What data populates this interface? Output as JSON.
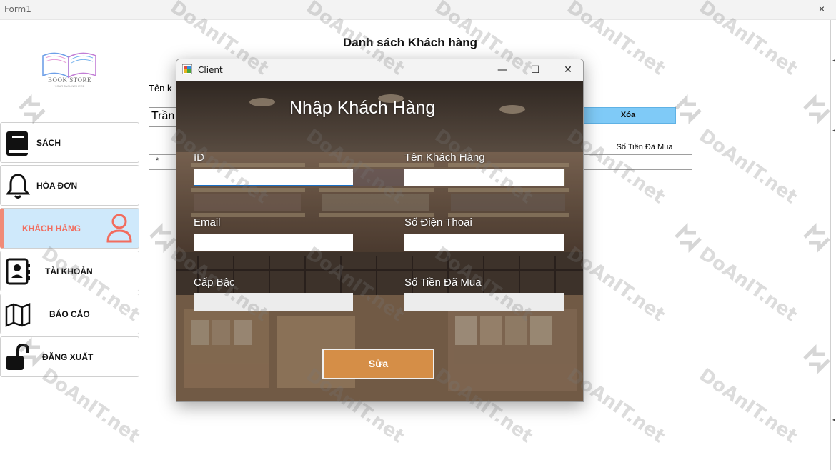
{
  "window": {
    "title": "Form1",
    "close_glyph": "×"
  },
  "logo": {
    "brand": "BOOK STORE",
    "tagline": "YOUR TAGLINE HERE"
  },
  "sidebar": {
    "items": [
      {
        "label": "SÁCH",
        "icon": "book-icon"
      },
      {
        "label": "HÓA ĐƠN",
        "icon": "bell-icon"
      },
      {
        "label": "KHÁCH HÀNG",
        "icon": "user-icon",
        "active": true
      },
      {
        "label": "TÀI KHOẢN",
        "icon": "contact-book-icon"
      },
      {
        "label": "BÁO CÁO",
        "icon": "map-icon"
      },
      {
        "label": "ĐĂNG XUẤT",
        "icon": "unlock-icon"
      }
    ]
  },
  "main": {
    "title": "Danh sách Khách hàng",
    "search_label": "Tên k",
    "search_value": "Trần",
    "delete_label": "Xóa",
    "grid": {
      "visible_header": "Số Tiền Đã Mua",
      "new_row_marker": "*"
    }
  },
  "dialog": {
    "title": "Client",
    "heading": "Nhập Khách Hàng",
    "controls": {
      "minimize": "—",
      "maximize": "☐",
      "close": "✕"
    },
    "fields": {
      "id": {
        "label": "ID",
        "value": ""
      },
      "name": {
        "label": "Tên Khách Hàng",
        "value": ""
      },
      "email": {
        "label": "Email",
        "value": ""
      },
      "phone": {
        "label": "Số Điện Thoại",
        "value": ""
      },
      "rank": {
        "label": "Cấp Bậc",
        "value": ""
      },
      "spent": {
        "label": "Số Tiền Đã Mua",
        "value": ""
      }
    },
    "submit_label": "Sửa"
  },
  "watermark": {
    "text": "DoAnIT.net"
  },
  "colors": {
    "active_menu_bg": "#cfe9fb",
    "active_menu_accent": "#f08b78",
    "delete_button": "#7fcaf7",
    "submit_button": "#d58e47",
    "focus_underline": "#1a6fc4"
  }
}
